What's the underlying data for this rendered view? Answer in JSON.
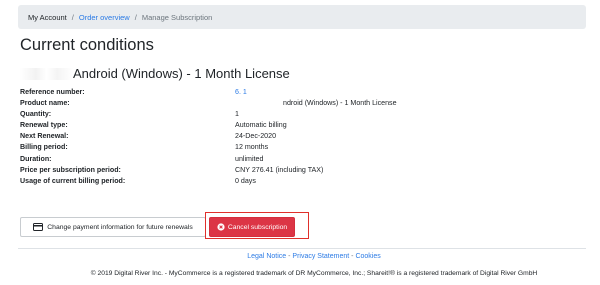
{
  "breadcrumb": {
    "items": [
      "My Account",
      "Order overview",
      "Manage Subscription"
    ],
    "separator": "/"
  },
  "title": "Current conditions",
  "product_title": "Android (Windows) - 1 Month License",
  "details": [
    {
      "label": "Reference number:",
      "value": "6.        1"
    },
    {
      "label": "Product name:",
      "value": "ndroid (Windows) - 1 Month License"
    },
    {
      "label": "Quantity:",
      "value": "1"
    },
    {
      "label": "Renewal type:",
      "value": "Automatic billing"
    },
    {
      "label": "Next Renewal:",
      "value": "24-Dec-2020"
    },
    {
      "label": "Billing period:",
      "value": "12 months"
    },
    {
      "label": "Duration:",
      "value": "unlimited"
    },
    {
      "label": "Price per subscription period:",
      "value": "CNY 276.41 (including TAX)"
    },
    {
      "label": "Usage of current billing period:",
      "value": "0 days"
    }
  ],
  "buttons": {
    "payment_label": "Change payment information for future renewals",
    "cancel_label": "Cancel subscription"
  },
  "footer": {
    "links": [
      "Legal Notice",
      "Privacy Statement",
      "Cookies"
    ],
    "link_separator": " - ",
    "copyright": "© 2019 Digital River Inc. - MyCommerce is a registered trademark of DR MyCommerce, Inc.; Shareit!® is a registered trademark of Digital River GmbH"
  },
  "colors": {
    "link": "#2c7be5",
    "danger": "#dc3545",
    "breadcrumb_bg": "#e9ecef",
    "highlight_frame": "#e0302b"
  },
  "icons": {
    "payment": "credit-card-icon",
    "cancel": "cancel-circle-icon"
  }
}
